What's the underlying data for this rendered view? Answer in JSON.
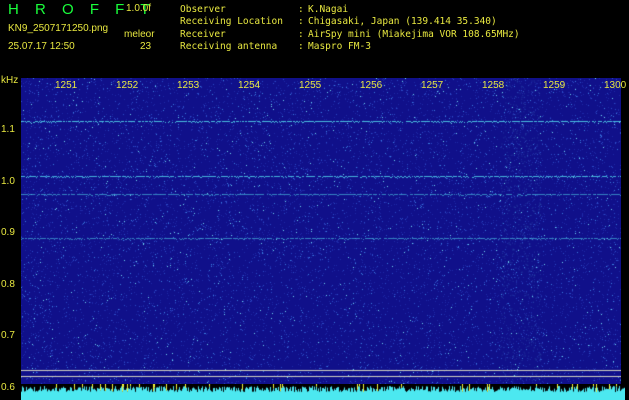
{
  "header": {
    "app_title": "H R O F F T",
    "version": "1.0.0f",
    "filename": "KN9_2507171250.png",
    "program": "meleor",
    "datetime": "25.07.17 12:50",
    "count": "23"
  },
  "info": {
    "labels": [
      "Observer",
      "Receiving Location",
      "Receiver",
      "Receiving antenna"
    ],
    "separator": ":",
    "values": [
      "K.Nagai",
      "Chigasaki, Japan (139.414 35.340)",
      "AirSpy mini (Miakejima VOR 108.65MHz)",
      "Maspro FM-3"
    ]
  },
  "spectrogram": {
    "y_unit": "kHz",
    "x_ticks": [
      "1251",
      "1252",
      "1253",
      "1254",
      "1255",
      "1256",
      "1257",
      "1258",
      "1259",
      "1300"
    ],
    "y_ticks": [
      "1.1",
      "1.0",
      "0.9",
      "0.8",
      "0.7",
      "0.6"
    ],
    "colors": {
      "background": "#10108a",
      "text": "#e8e840",
      "title": "#19ff3c",
      "trace": "#4fd0e8",
      "bars": "#4ce8f0"
    }
  }
}
